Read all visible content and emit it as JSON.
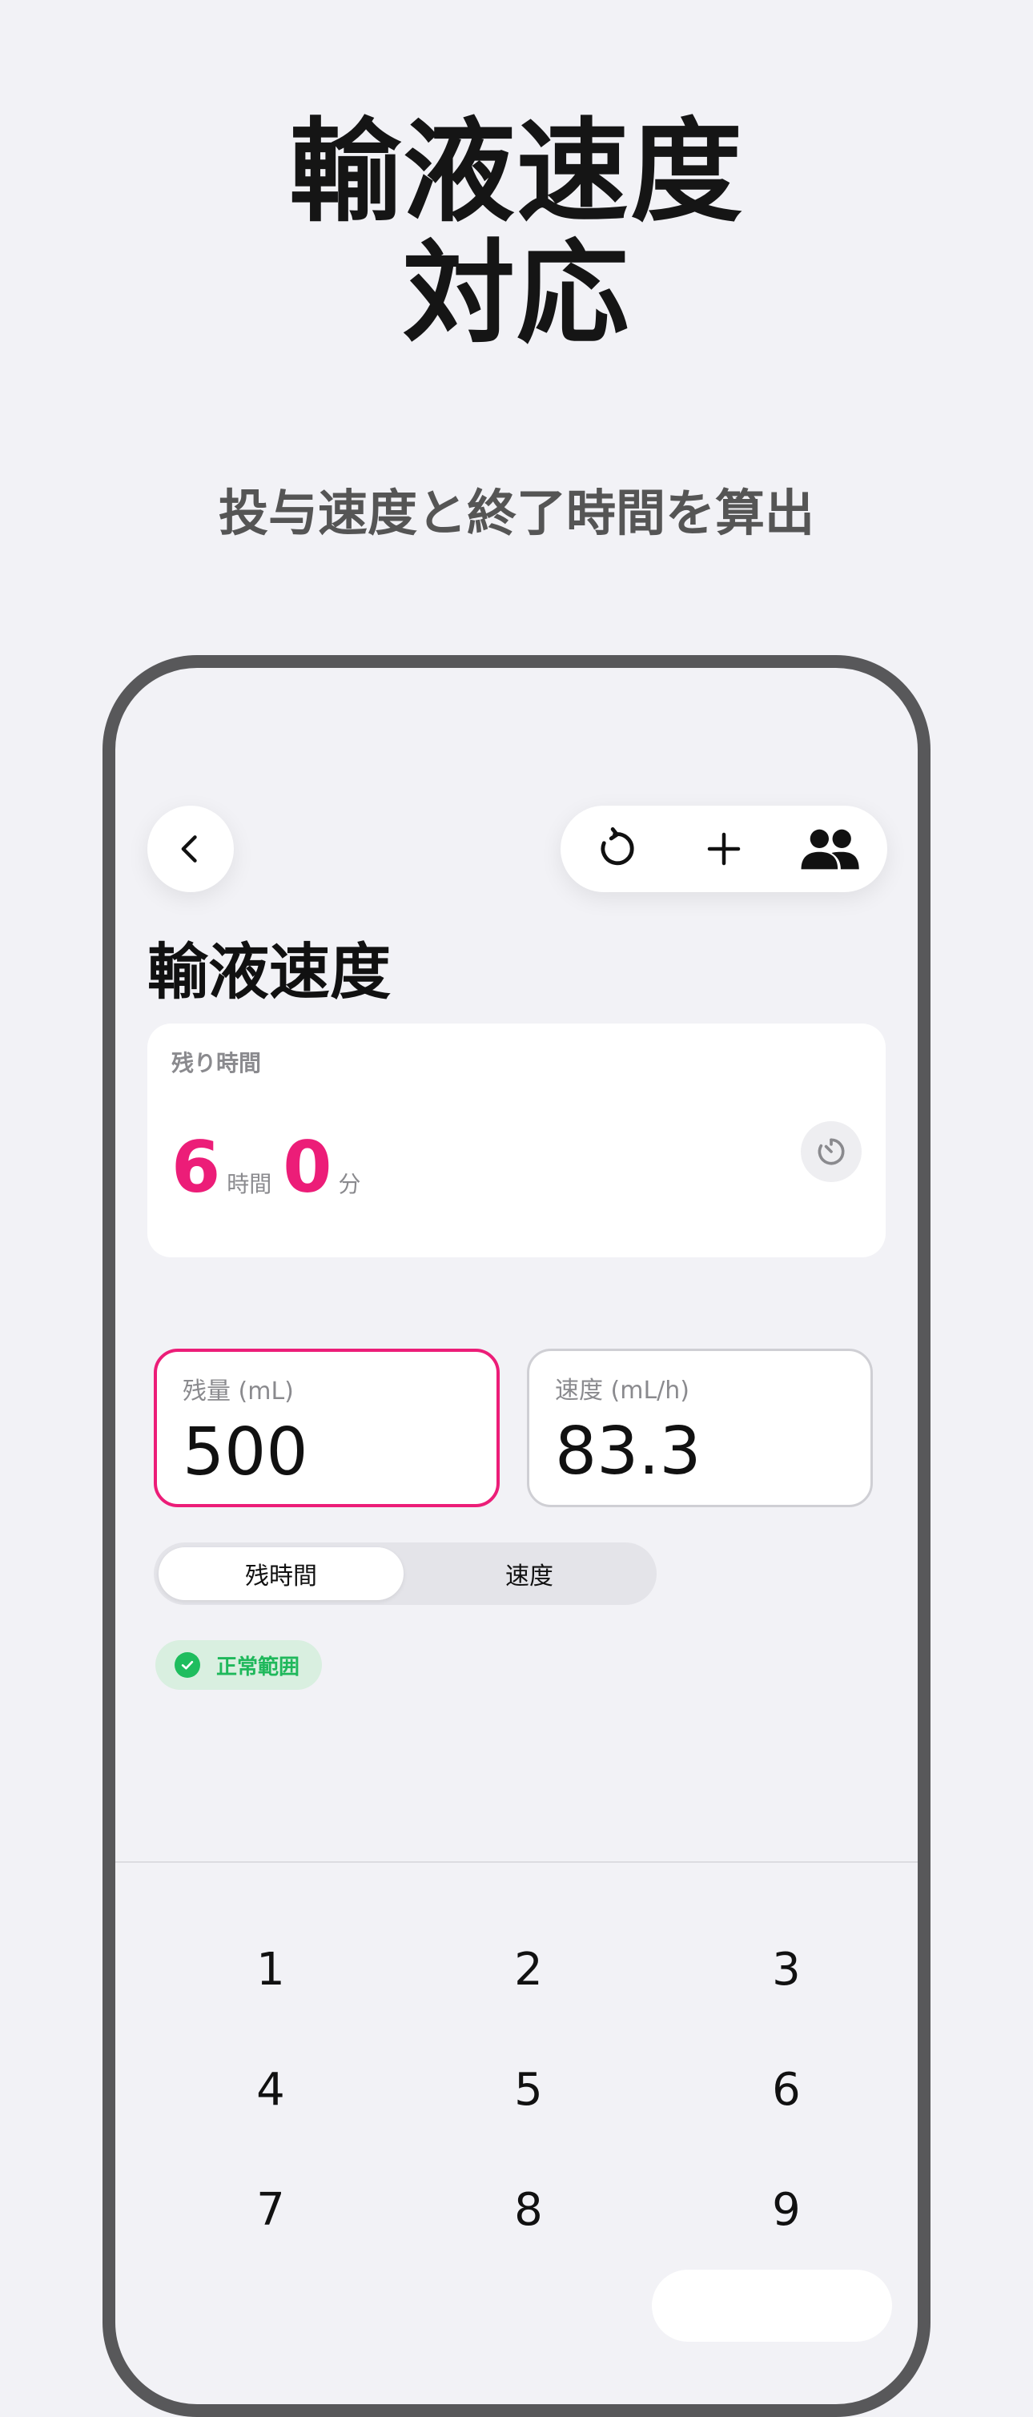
{
  "promo": {
    "title_line1": "輸液速度",
    "title_line2": "対応",
    "subtitle": "投与速度と終了時間を算出"
  },
  "toolbar": {
    "back_icon": "chevron-left-icon",
    "reset_icon": "rotate-ccw-icon",
    "add_icon": "plus-icon",
    "users_icon": "users-icon"
  },
  "page": {
    "title": "輸液速度"
  },
  "remaining": {
    "label": "残り時間",
    "hours": "6",
    "hours_unit": "時間",
    "minutes": "0",
    "minutes_unit": "分",
    "timer_icon": "timer-icon"
  },
  "fields": {
    "volume": {
      "label": "残量 (mL)",
      "value": "500"
    },
    "rate": {
      "label": "速度 (mL/h)",
      "value": "83.3"
    }
  },
  "segmented": {
    "options": [
      "残時間",
      "速度"
    ],
    "selected": "残時間"
  },
  "status": {
    "label": "正常範囲",
    "color": "#1fb85b"
  },
  "keypad": {
    "keys": [
      "1",
      "2",
      "3",
      "4",
      "5",
      "6",
      "7",
      "8",
      "9"
    ]
  },
  "colors": {
    "accent": "#ec1d78",
    "frame": "#58585a",
    "background": "#f2f2f6"
  }
}
